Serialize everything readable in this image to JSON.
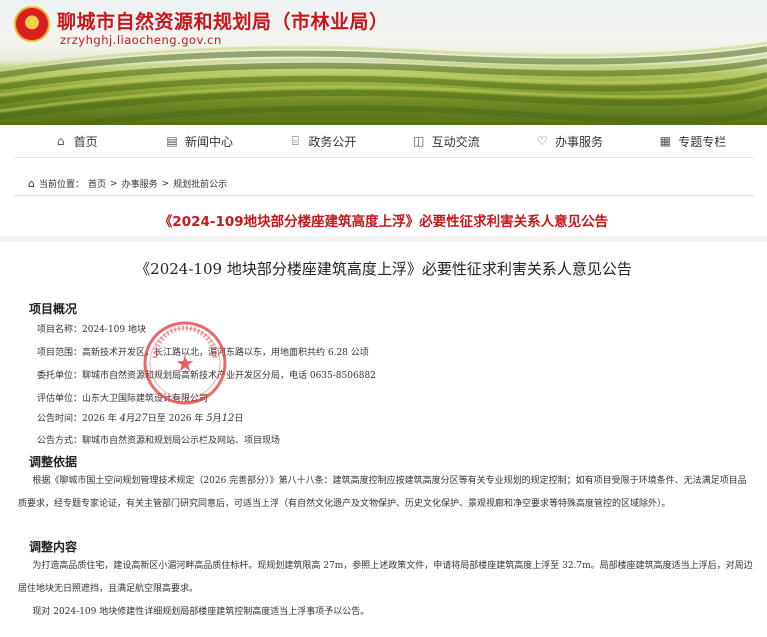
{
  "header": {
    "title": "聊城市自然资源和规划局（市林业局）",
    "domain": "zrzyhghj.liaocheng.gov.cn",
    "emblem_icon": "national-emblem"
  },
  "nav": {
    "items": [
      {
        "label": "首页",
        "icon": "home-icon"
      },
      {
        "label": "新闻中心",
        "icon": "news-icon"
      },
      {
        "label": "政务公开",
        "icon": "bank-icon"
      },
      {
        "label": "互动交流",
        "icon": "chat-icon"
      },
      {
        "label": "办事服务",
        "icon": "heart-icon"
      },
      {
        "label": "专题专栏",
        "icon": "calendar-icon"
      }
    ]
  },
  "breadcrumb": {
    "prefix": "当前位置：",
    "items": [
      "首页",
      "办事服务",
      "规划批前公示"
    ],
    "separator": ">"
  },
  "page_title": "《2024-109地块部分楼座建筑高度上浮》必要性征求利害关系人意见公告",
  "document": {
    "title": "《2024-109 地块部分楼座建筑高度上浮》必要性征求利害关系人意见公告",
    "overview_heading": "项目概况",
    "overview_rows": [
      "项目名称：2024-109 地块",
      "项目范围：高新技术开发区，长江路以北，湄河东路以东，用地面积共约 6.28 公顷",
      "委托单位：聊城市自然资源和规划局高新技术产业开发区分局，电话 0635-8506882",
      "评估单位：山东大卫国际建筑设计有限公司"
    ],
    "time_prefix": "公告时间：2026 年",
    "time_start_month": "4",
    "time_start_day": "27",
    "time_mid": "日至 2026 年",
    "time_end_month": "5",
    "time_end_day": "12",
    "time_suffix": "日",
    "method": "公告方式：聊城市自然资源和规划局公示栏及网站、项目现场",
    "basis_heading": "调整依据",
    "basis_text": "根据《聊城市国土空间规划管理技术规定（2026 完善部分）》第八十八条：建筑高度控制应按建筑高度分区等有关专业规划的规定控制；如有项目受限于环境条件、无法满足项目品质要求，经专题专家论证，有关主管部门研究同意后，可适当上浮（有自然文化遗产及文物保护、历史文化保护、景观视廊和净空要求等特殊高度管控的区域除外）。",
    "content_heading": "调整内容",
    "content_text": "为打造高品质住宅，建设高新区小湄河畔高品质住标杆。现规划建筑限高 27m，参照上述政策文件，申请将局部楼座建筑高度上浮至 32.7m。局部楼座建筑高度适当上浮后，对周边居住地块无日照遮挡，且满足航空限高要求。",
    "closing_text": "现对 2024-109 地块修建性详细规划局部楼座建筑控制高度适当上浮事项予以公告。"
  },
  "colors": {
    "brand_red": "#c8161d",
    "seal_red": "#e03a3a"
  }
}
